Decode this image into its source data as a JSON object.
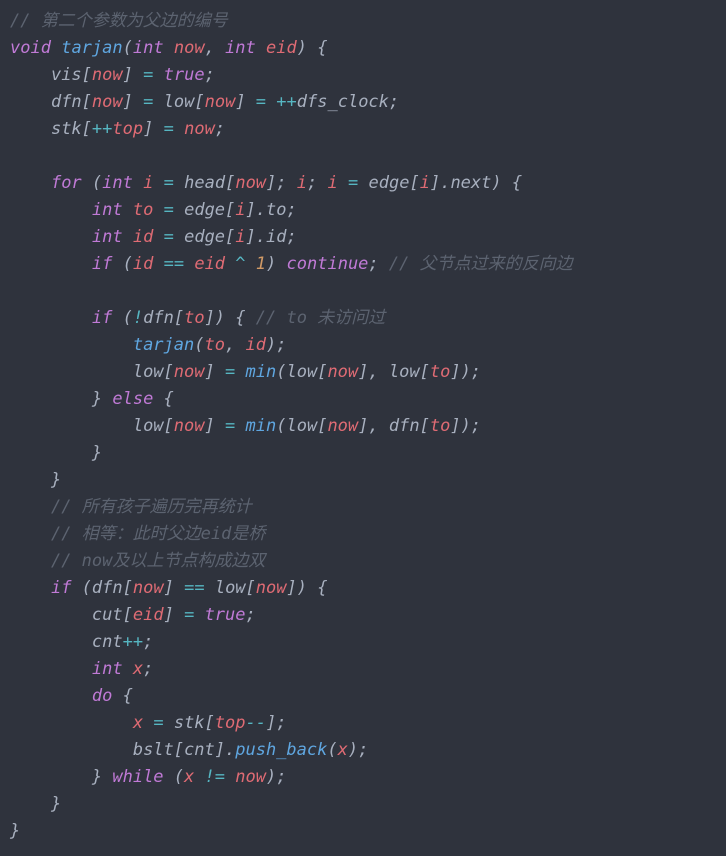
{
  "code": {
    "tokens": [
      [
        [
          "cm",
          "// 第二个参数为父边的编号"
        ]
      ],
      [
        [
          "kw",
          "void"
        ],
        [
          "pn",
          " "
        ],
        [
          "fn",
          "tarjan"
        ],
        [
          "pn",
          "("
        ],
        [
          "kw",
          "int"
        ],
        [
          "pn",
          " "
        ],
        [
          "id",
          "now"
        ],
        [
          "pn",
          ", "
        ],
        [
          "kw",
          "int"
        ],
        [
          "pn",
          " "
        ],
        [
          "id",
          "eid"
        ],
        [
          "pn",
          ") {"
        ]
      ],
      [
        [
          "pn",
          "    "
        ],
        [
          "var",
          "vis"
        ],
        [
          "pn",
          "["
        ],
        [
          "id",
          "now"
        ],
        [
          "pn",
          "] "
        ],
        [
          "op",
          "="
        ],
        [
          "pn",
          " "
        ],
        [
          "kw",
          "true"
        ],
        [
          "pn",
          ";"
        ]
      ],
      [
        [
          "pn",
          "    "
        ],
        [
          "var",
          "dfn"
        ],
        [
          "pn",
          "["
        ],
        [
          "id",
          "now"
        ],
        [
          "pn",
          "] "
        ],
        [
          "op",
          "="
        ],
        [
          "pn",
          " "
        ],
        [
          "var",
          "low"
        ],
        [
          "pn",
          "["
        ],
        [
          "id",
          "now"
        ],
        [
          "pn",
          "] "
        ],
        [
          "op",
          "="
        ],
        [
          "pn",
          " "
        ],
        [
          "op",
          "++"
        ],
        [
          "var",
          "dfs_clock"
        ],
        [
          "pn",
          ";"
        ]
      ],
      [
        [
          "pn",
          "    "
        ],
        [
          "var",
          "stk"
        ],
        [
          "pn",
          "["
        ],
        [
          "op",
          "++"
        ],
        [
          "id",
          "top"
        ],
        [
          "pn",
          "] "
        ],
        [
          "op",
          "="
        ],
        [
          "pn",
          " "
        ],
        [
          "id",
          "now"
        ],
        [
          "pn",
          ";"
        ]
      ],
      [
        [
          "pn",
          ""
        ]
      ],
      [
        [
          "pn",
          "    "
        ],
        [
          "kw",
          "for"
        ],
        [
          "pn",
          " ("
        ],
        [
          "kw",
          "int"
        ],
        [
          "pn",
          " "
        ],
        [
          "id",
          "i"
        ],
        [
          "pn",
          " "
        ],
        [
          "op",
          "="
        ],
        [
          "pn",
          " "
        ],
        [
          "var",
          "head"
        ],
        [
          "pn",
          "["
        ],
        [
          "id",
          "now"
        ],
        [
          "pn",
          "]; "
        ],
        [
          "id",
          "i"
        ],
        [
          "pn",
          "; "
        ],
        [
          "id",
          "i"
        ],
        [
          "pn",
          " "
        ],
        [
          "op",
          "="
        ],
        [
          "pn",
          " "
        ],
        [
          "var",
          "edge"
        ],
        [
          "pn",
          "["
        ],
        [
          "id",
          "i"
        ],
        [
          "pn",
          "]."
        ],
        [
          "var",
          "next"
        ],
        [
          "pn",
          ") {"
        ]
      ],
      [
        [
          "pn",
          "        "
        ],
        [
          "kw",
          "int"
        ],
        [
          "pn",
          " "
        ],
        [
          "id",
          "to"
        ],
        [
          "pn",
          " "
        ],
        [
          "op",
          "="
        ],
        [
          "pn",
          " "
        ],
        [
          "var",
          "edge"
        ],
        [
          "pn",
          "["
        ],
        [
          "id",
          "i"
        ],
        [
          "pn",
          "]."
        ],
        [
          "var",
          "to"
        ],
        [
          "pn",
          ";"
        ]
      ],
      [
        [
          "pn",
          "        "
        ],
        [
          "kw",
          "int"
        ],
        [
          "pn",
          " "
        ],
        [
          "id",
          "id"
        ],
        [
          "pn",
          " "
        ],
        [
          "op",
          "="
        ],
        [
          "pn",
          " "
        ],
        [
          "var",
          "edge"
        ],
        [
          "pn",
          "["
        ],
        [
          "id",
          "i"
        ],
        [
          "pn",
          "]."
        ],
        [
          "var",
          "id"
        ],
        [
          "pn",
          ";"
        ]
      ],
      [
        [
          "pn",
          "        "
        ],
        [
          "kw",
          "if"
        ],
        [
          "pn",
          " ("
        ],
        [
          "id",
          "id"
        ],
        [
          "pn",
          " "
        ],
        [
          "op",
          "=="
        ],
        [
          "pn",
          " "
        ],
        [
          "id",
          "eid"
        ],
        [
          "pn",
          " "
        ],
        [
          "op",
          "^"
        ],
        [
          "pn",
          " "
        ],
        [
          "nu",
          "1"
        ],
        [
          "pn",
          ") "
        ],
        [
          "kw",
          "continue"
        ],
        [
          "pn",
          "; "
        ],
        [
          "cm",
          "// 父节点过来的反向边"
        ]
      ],
      [
        [
          "pn",
          ""
        ]
      ],
      [
        [
          "pn",
          "        "
        ],
        [
          "kw",
          "if"
        ],
        [
          "pn",
          " ("
        ],
        [
          "op",
          "!"
        ],
        [
          "var",
          "dfn"
        ],
        [
          "pn",
          "["
        ],
        [
          "id",
          "to"
        ],
        [
          "pn",
          "]) { "
        ],
        [
          "cm",
          "// to 未访问过"
        ]
      ],
      [
        [
          "pn",
          "            "
        ],
        [
          "fn",
          "tarjan"
        ],
        [
          "pn",
          "("
        ],
        [
          "id",
          "to"
        ],
        [
          "pn",
          ", "
        ],
        [
          "id",
          "id"
        ],
        [
          "pn",
          ");"
        ]
      ],
      [
        [
          "pn",
          "            "
        ],
        [
          "var",
          "low"
        ],
        [
          "pn",
          "["
        ],
        [
          "id",
          "now"
        ],
        [
          "pn",
          "] "
        ],
        [
          "op",
          "="
        ],
        [
          "pn",
          " "
        ],
        [
          "fn",
          "min"
        ],
        [
          "pn",
          "("
        ],
        [
          "var",
          "low"
        ],
        [
          "pn",
          "["
        ],
        [
          "id",
          "now"
        ],
        [
          "pn",
          "], "
        ],
        [
          "var",
          "low"
        ],
        [
          "pn",
          "["
        ],
        [
          "id",
          "to"
        ],
        [
          "pn",
          "]);"
        ]
      ],
      [
        [
          "pn",
          "        } "
        ],
        [
          "kw",
          "else"
        ],
        [
          "pn",
          " {"
        ]
      ],
      [
        [
          "pn",
          "            "
        ],
        [
          "var",
          "low"
        ],
        [
          "pn",
          "["
        ],
        [
          "id",
          "now"
        ],
        [
          "pn",
          "] "
        ],
        [
          "op",
          "="
        ],
        [
          "pn",
          " "
        ],
        [
          "fn",
          "min"
        ],
        [
          "pn",
          "("
        ],
        [
          "var",
          "low"
        ],
        [
          "pn",
          "["
        ],
        [
          "id",
          "now"
        ],
        [
          "pn",
          "], "
        ],
        [
          "var",
          "dfn"
        ],
        [
          "pn",
          "["
        ],
        [
          "id",
          "to"
        ],
        [
          "pn",
          "]);"
        ]
      ],
      [
        [
          "pn",
          "        }"
        ]
      ],
      [
        [
          "pn",
          "    }"
        ]
      ],
      [
        [
          "pn",
          "    "
        ],
        [
          "cm",
          "// 所有孩子遍历完再统计"
        ]
      ],
      [
        [
          "pn",
          "    "
        ],
        [
          "cm",
          "// 相等：此时父边eid是桥"
        ]
      ],
      [
        [
          "pn",
          "    "
        ],
        [
          "cm",
          "// now及以上节点构成边双"
        ]
      ],
      [
        [
          "pn",
          "    "
        ],
        [
          "kw",
          "if"
        ],
        [
          "pn",
          " ("
        ],
        [
          "var",
          "dfn"
        ],
        [
          "pn",
          "["
        ],
        [
          "id",
          "now"
        ],
        [
          "pn",
          "] "
        ],
        [
          "op",
          "=="
        ],
        [
          "pn",
          " "
        ],
        [
          "var",
          "low"
        ],
        [
          "pn",
          "["
        ],
        [
          "id",
          "now"
        ],
        [
          "pn",
          "]) {"
        ]
      ],
      [
        [
          "pn",
          "        "
        ],
        [
          "var",
          "cut"
        ],
        [
          "pn",
          "["
        ],
        [
          "id",
          "eid"
        ],
        [
          "pn",
          "] "
        ],
        [
          "op",
          "="
        ],
        [
          "pn",
          " "
        ],
        [
          "kw",
          "true"
        ],
        [
          "pn",
          ";"
        ]
      ],
      [
        [
          "pn",
          "        "
        ],
        [
          "var",
          "cnt"
        ],
        [
          "op",
          "++"
        ],
        [
          "pn",
          ";"
        ]
      ],
      [
        [
          "pn",
          "        "
        ],
        [
          "kw",
          "int"
        ],
        [
          "pn",
          " "
        ],
        [
          "id",
          "x"
        ],
        [
          "pn",
          ";"
        ]
      ],
      [
        [
          "pn",
          "        "
        ],
        [
          "kw",
          "do"
        ],
        [
          "pn",
          " {"
        ]
      ],
      [
        [
          "pn",
          "            "
        ],
        [
          "id",
          "x"
        ],
        [
          "pn",
          " "
        ],
        [
          "op",
          "="
        ],
        [
          "pn",
          " "
        ],
        [
          "var",
          "stk"
        ],
        [
          "pn",
          "["
        ],
        [
          "id",
          "top"
        ],
        [
          "op",
          "--"
        ],
        [
          "pn",
          "];"
        ]
      ],
      [
        [
          "pn",
          "            "
        ],
        [
          "var",
          "bslt"
        ],
        [
          "pn",
          "["
        ],
        [
          "var",
          "cnt"
        ],
        [
          "pn",
          "]."
        ],
        [
          "fn",
          "push_back"
        ],
        [
          "pn",
          "("
        ],
        [
          "id",
          "x"
        ],
        [
          "pn",
          ");"
        ]
      ],
      [
        [
          "pn",
          "        } "
        ],
        [
          "kw",
          "while"
        ],
        [
          "pn",
          " ("
        ],
        [
          "id",
          "x"
        ],
        [
          "pn",
          " "
        ],
        [
          "op",
          "!="
        ],
        [
          "pn",
          " "
        ],
        [
          "id",
          "now"
        ],
        [
          "pn",
          ");"
        ]
      ],
      [
        [
          "pn",
          "    }"
        ]
      ],
      [
        [
          "pn",
          "}"
        ]
      ]
    ]
  }
}
